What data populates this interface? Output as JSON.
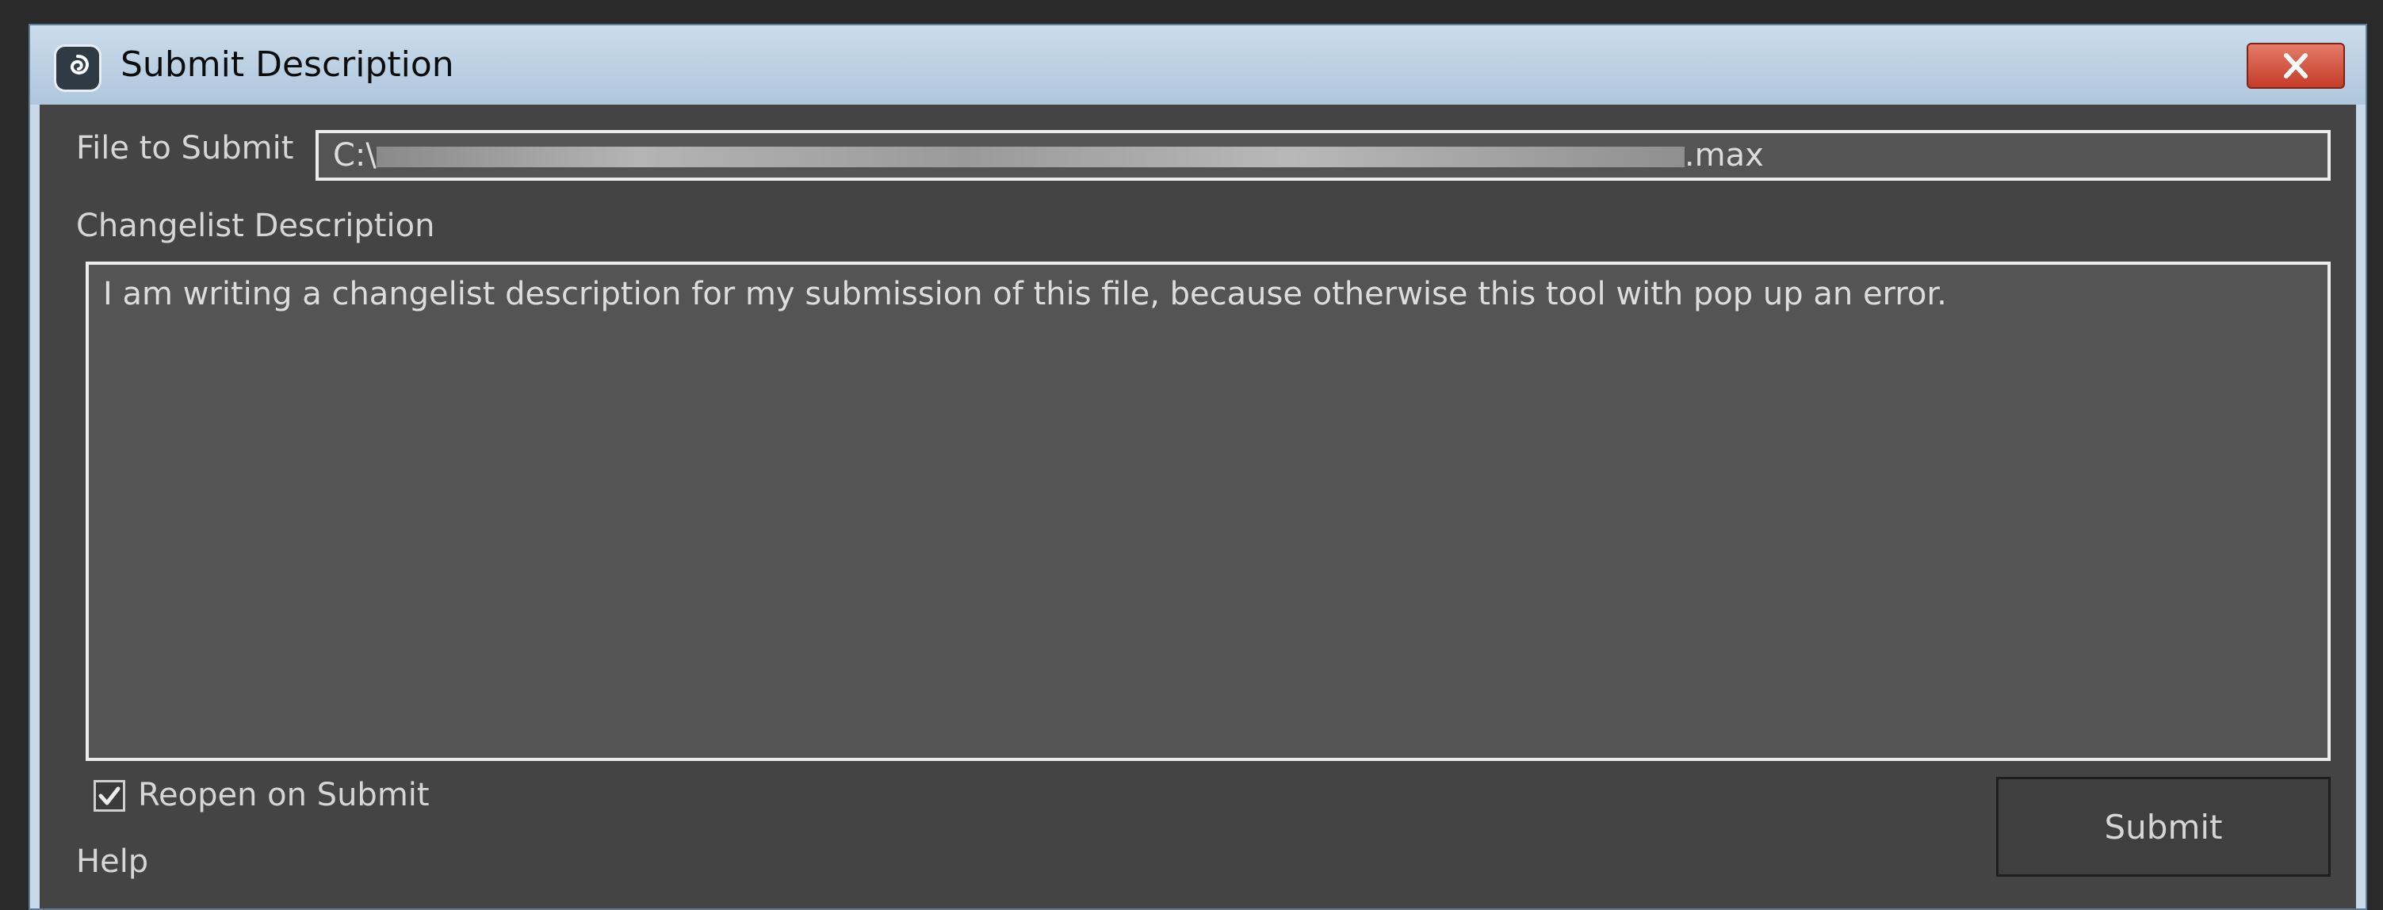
{
  "window": {
    "title": "Submit Description",
    "app_icon": "3ds-max-logo-icon",
    "close_icon": "close-x-icon"
  },
  "form": {
    "file_label": "File to Submit",
    "file_value_prefix": "C:\\",
    "file_value_suffix": ".max",
    "description_label": "Changelist Description",
    "description_value": "I am writing a changelist description for my submission of this file, because otherwise this tool with pop up an error.",
    "reopen_label": "Reopen on Submit",
    "reopen_checked": true,
    "help_label": "Help",
    "submit_label": "Submit"
  },
  "colors": {
    "client_bg": "#444444",
    "field_bg": "#545454",
    "close_button": "#c43b26",
    "titlebar": "#bcd0e4"
  }
}
